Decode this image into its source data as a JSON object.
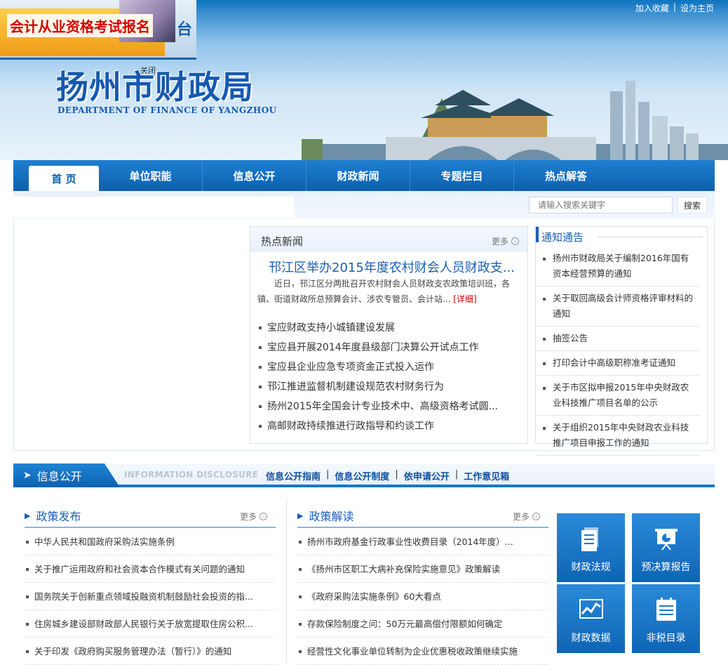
{
  "top_links": {
    "favorite": "加入收藏",
    "separator": "|",
    "homepage": "设为主页"
  },
  "ad": {
    "title": "会计从业资格考试报名",
    "suffix": "台",
    "close": "关闭"
  },
  "logo": {
    "cn": "扬州市财政局",
    "en": "DEPARTMENT OF FINANCE OF YANGZHOU"
  },
  "nav": {
    "items": [
      "首 页",
      "单位职能",
      "信息公开",
      "财政新闻",
      "专题栏目",
      "热点解答"
    ]
  },
  "search": {
    "placeholder": "请输入搜索关键字",
    "button": "搜索"
  },
  "hot_news": {
    "title": "热点新闻",
    "more": "更多",
    "headline": "邗江区举办2015年度农村财会人员财政支...",
    "summary": "近日，邗江区分两批召开农村财会人员财政支农政策培训班，各镇、街道财政所总预算会计、涉农专管员、会计站...",
    "detail": "[详细]",
    "items": [
      "宝应财政支持小城镇建设发展",
      "宝应县开展2014年度县级部门决算公开试点工作",
      "宝应县企业应急专项资金正式投入运作",
      "邗江推进监督机制建设规范农村财务行为",
      "扬州2015年全国会计专业技术中、高级资格考试圆...",
      "高邮财政持续推进行政指导和约谈工作"
    ]
  },
  "notices": {
    "title": "通知通告",
    "items": [
      "扬州市财政局关于编制2016年国有资本经营预算的通知",
      "关于取回高级会计师资格评审材料的通知",
      "抽签公告",
      "打印会计中高级职称准考证通知",
      "关于市区拟申报2015年中央财政农业科技推广项目名单的公示",
      "关于组织2015年中央财政农业科技推广项目申报工作的通知"
    ]
  },
  "info_section": {
    "title": "信息公开",
    "en": "INFORMATION DISCLOSURE",
    "links": [
      "信息公开指南",
      "信息公开制度",
      "依申请公开",
      "工作意见箱"
    ]
  },
  "policy_release": {
    "title": "政策发布",
    "more": "更多",
    "items": [
      "中华人民共和国政府采购法实施条例",
      "关于推广运用政府和社会资本合作模式有关问题的通知",
      "国务院关于创新重点领域投融资机制鼓励社会投资的指...",
      "住房城乡建设部财政部人民银行关于放宽提取住房公积...",
      "关于印发《政府购买服务管理办法（暂行）》的通知"
    ]
  },
  "policy_reading": {
    "title": "政策解读",
    "more": "更多",
    "items": [
      "扬州市政府基金行政事业性收费目录（2014年度）...",
      "《扬州市区职工大病补充保险实施意见》政策解读",
      "《政府采购法实施条例》60大看点",
      "存款保险制度之问：50万元最高偿付限额如何确定",
      "经营性文化事业单位转制为企业优惠税收政策继续实施"
    ]
  },
  "tiles": [
    "财政法规",
    "预决算报告",
    "财政数据",
    "非税目录"
  ],
  "colors": {
    "primary": "#0d5fae",
    "link": "#1a5fb4",
    "detail": "#cc0000",
    "ad_red": "#d40000"
  }
}
